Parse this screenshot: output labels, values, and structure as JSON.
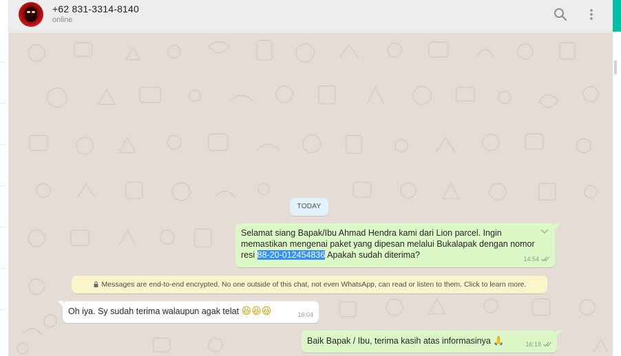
{
  "contact": {
    "name": "+62 831-3314-8140",
    "status": "online"
  },
  "header_icons": [
    "search-icon",
    "menu-icon"
  ],
  "chat": {
    "day_label": "TODAY",
    "messages": [
      {
        "direction": "outgoing",
        "text_before": "Selamat siang Bapak/Ibu Ahmad Hendra kami dari Lion parcel. Ingin memastikan mengenai paket yang dipesan melalui Bukalapak dengan nomor resi ",
        "highlighted": "88-20-012454836",
        "text_after": " Apakah sudah diterima?",
        "time": "14:54",
        "status": "delivered"
      },
      {
        "direction": "incoming",
        "text": "Oh iya. Sy sudah terima walaupun agak telat ",
        "emoji": "😆😆😆",
        "time": "16:04"
      },
      {
        "direction": "outgoing",
        "text": "Baik Bapak / Ibu, terima kasih atas informasinya ",
        "emoji": "🙏",
        "time": "16:18",
        "status": "delivered"
      }
    ],
    "encryption_notice": "Messages are end-to-end encrypted. No one outside of this chat, not even WhatsApp, can read or listen to them. Click to learn more."
  },
  "colors": {
    "header_bg": "#ededed",
    "chat_bg": "#e5ddd5",
    "outgoing_bubble": "#dcf8c6",
    "incoming_bubble": "#ffffff",
    "notice_bg": "#fcf4cb",
    "day_chip_bg": "#e1f2fb",
    "accent": "#00bfa5",
    "selection": "#3390ff"
  }
}
